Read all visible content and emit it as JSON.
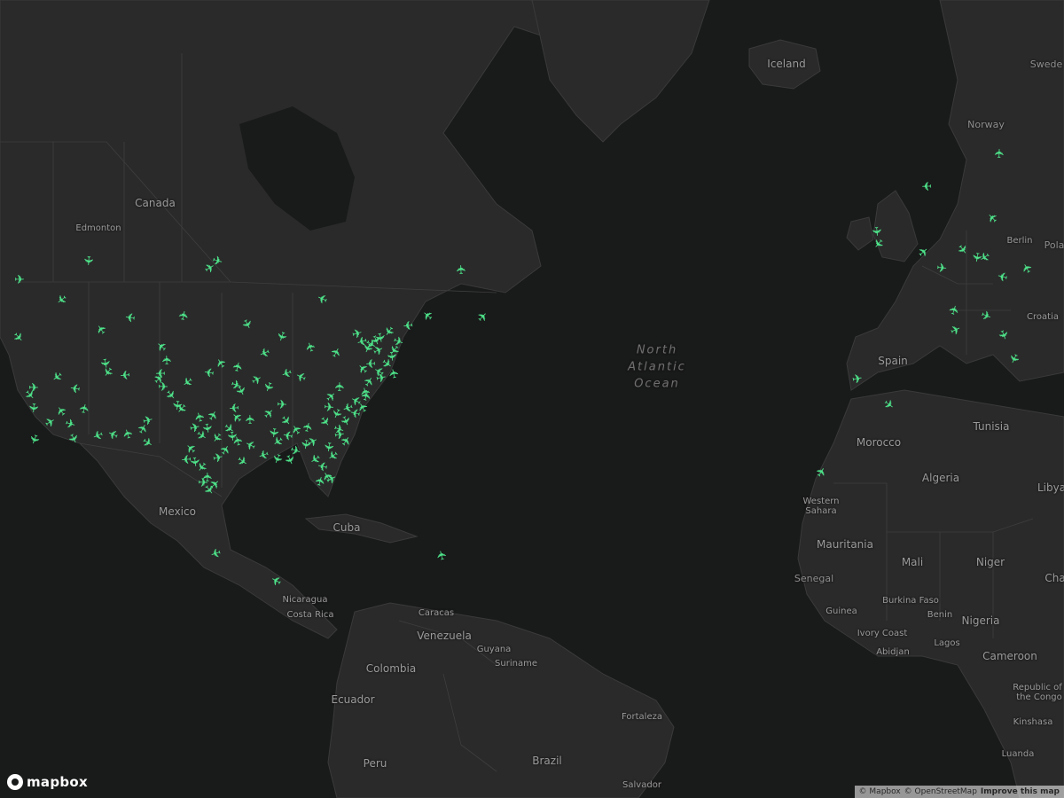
{
  "map": {
    "style": "dark",
    "colors": {
      "water": "#191a1a",
      "land": "#2a2a2a",
      "border": "#3e3e3e",
      "label": "#8d8d8d",
      "plane": "#4ee38a"
    },
    "icon": "airplane-icon"
  },
  "labels": {
    "canada": "Canada",
    "edmonton": "Edmonton",
    "iceland": "Iceland",
    "norway": "Norway",
    "sweden": "Swede",
    "berlin": "Berlin",
    "poland": "Pola",
    "croatia": "Croatia",
    "spain": "Spain",
    "morocco": "Morocco",
    "tunisia": "Tunisia",
    "algeria": "Algeria",
    "libya": "Libya",
    "western_sahara_1": "Western",
    "western_sahara_2": "Sahara",
    "mauritania": "Mauritania",
    "mali": "Mali",
    "niger": "Niger",
    "chad": "Cha",
    "senegal": "Senegal",
    "guinea": "Guinea",
    "burkina_faso": "Burkina Faso",
    "benin": "Benin",
    "nigeria": "Nigeria",
    "ivory_coast": "Ivory Coast",
    "abidjan": "Abidjan",
    "lagos": "Lagos",
    "cameroon": "Cameroon",
    "republic_congo_1": "Republic of",
    "republic_congo_2": "the Congo",
    "kinshasa": "Kinshasa",
    "luanda": "Luanda",
    "mexico": "Mexico",
    "cuba": "Cuba",
    "nicaragua": "Nicaragua",
    "costa_rica": "Costa Rica",
    "caracas": "Caracas",
    "venezuela": "Venezuela",
    "guyana": "Guyana",
    "suriname": "Suriname",
    "colombia": "Colombia",
    "ecuador": "Ecuador",
    "peru": "Peru",
    "brazil": "Brazil",
    "fortaleza": "Fortaleza",
    "salvador": "Salvador",
    "ocean_1": "North",
    "ocean_2": "Atlantic",
    "ocean_3": "Ocean"
  },
  "logo": {
    "text": "mapbox"
  },
  "attribution": {
    "mapbox": "© Mapbox",
    "osm": "© OpenStreetMap",
    "improve": "Improve this map"
  }
}
